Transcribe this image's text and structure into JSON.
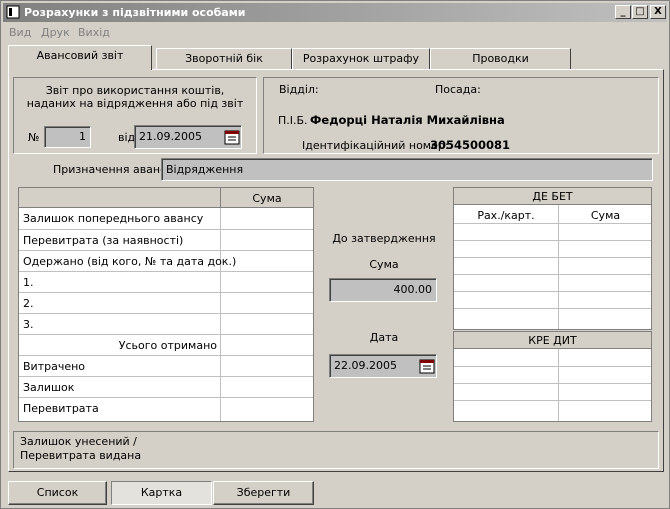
{
  "window": {
    "title": "Розрахунки з підзвітними особами",
    "controls": {
      "minimize": "_",
      "maximize": "□",
      "close": "X"
    }
  },
  "menu": [
    "Вид",
    "Друк",
    "Вихід"
  ],
  "tabs": [
    "Авансовий звіт",
    "Зворотній бік",
    "Розрахунок штрафу",
    "Проводки"
  ],
  "report": {
    "heading_line1": "Звіт про використання коштів,",
    "heading_line2": "наданих на відрядження або під звіт",
    "number_label": "№",
    "number_value": "1",
    "date_label": "від",
    "date_value": "21.09.2005"
  },
  "person": {
    "department_label": "Відділ:",
    "position_label": "Посада:",
    "name_label": "П.І.Б.",
    "name_value": "Федорці Наталія Михайлівна",
    "id_label": "Ідентифікаційний номер:",
    "id_value": "3054500081"
  },
  "purpose": {
    "label": "Призначення авансу",
    "value": "Відрядження"
  },
  "left_table": {
    "sum_header": "Сума",
    "rows": [
      "Залишок  попереднього авансу",
      "Перевитрата  (за наявності)",
      "Одержано (від кого, № та дата док.)",
      "1.",
      "2.",
      "3.",
      "Усього отримано",
      "Витрачено",
      "Залишок",
      "Перевитрата"
    ]
  },
  "approval": {
    "title": "До затвердження",
    "sum_label": "Сума",
    "sum_value": "400.00",
    "date_label": "Дата",
    "date_value": "22.09.2005"
  },
  "debit": {
    "title": "ДЕ БЕТ",
    "col1": "Рах./карт.",
    "col2": "Сума"
  },
  "credit": {
    "title": "КРЕ ДИТ"
  },
  "bottom_note": {
    "line1": "Залишок  унесений /",
    "line2": "Перевитрата видана"
  },
  "buttons": [
    "Список",
    "Картка",
    "Зберегти"
  ]
}
